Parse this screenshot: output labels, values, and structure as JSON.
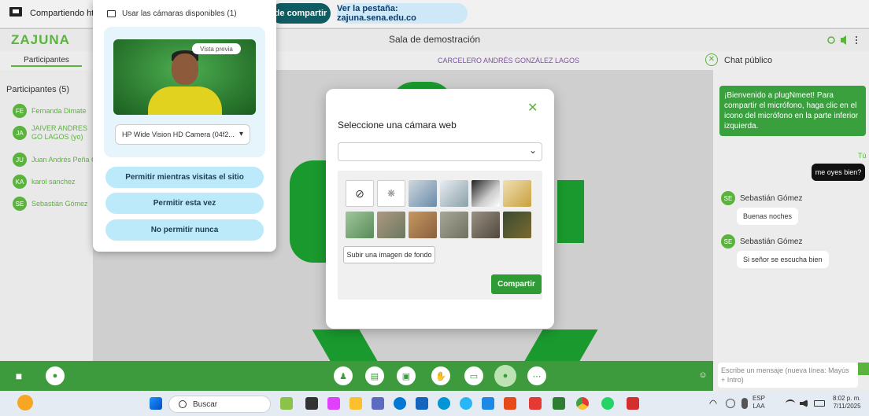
{
  "sharebar": {
    "text": "Compartiendo htt",
    "stop_label": "de compartir",
    "tab_label": "Ver la pestaña: zajuna.sena.edu.co"
  },
  "header": {
    "logo": "ZAJUNA",
    "room": "Sala de demostración"
  },
  "subheader": {
    "tab": "Participantes",
    "speaker": "CARCELERO ANDRÉS GONZÁLEZ LAGOS",
    "chat_title": "Chat público"
  },
  "participants": {
    "title": "Participantes (5)",
    "items": [
      {
        "initials": "FE",
        "name": "Fernanda Dimate"
      },
      {
        "initials": "JA",
        "name": "JAIVER ANDRES GO LAGOS (yo)"
      },
      {
        "initials": "JU",
        "name": "Juan Andrés Peña C"
      },
      {
        "initials": "KA",
        "name": "karol sanchez"
      },
      {
        "initials": "SE",
        "name": "Sebastián Gómez"
      }
    ]
  },
  "camera_popup": {
    "header": "Usar las cámaras disponibles (1)",
    "preview": "Vista previa",
    "device": "HP Wide Vision HD Camera (04f2...",
    "allow_visit": "Permitir mientras visitas el sitio",
    "allow_once": "Permitir esta vez",
    "never": "No permitir nunca"
  },
  "modal": {
    "title": "Seleccione una cámara web",
    "upload": "Subir una imagen de fondo",
    "share": "Compartir",
    "close": "✕"
  },
  "chat": {
    "welcome": "¡Bienvenido a plugNmeet! Para compartir el micrófono, haga clic en el icono del micrófono en la parte inferior izquierda.",
    "me_label": "Tú",
    "my_message": "me oyes bien?",
    "messages": [
      {
        "initials": "SE",
        "sender": "Sebastián Gómez",
        "text": "Buenas noches"
      },
      {
        "initials": "SE",
        "sender": "Sebastián Gómez",
        "text": "Si señor se escucha bien"
      }
    ],
    "input_placeholder": "Escribe un mensaje (nueva línea: Mayús + Intro)"
  },
  "taskbar": {
    "search": "Buscar",
    "lang": "ESP",
    "lang2": "LAA",
    "time": "8:02 p. m.",
    "date": "7/11/2025"
  },
  "colors": {
    "accent": "#5ab33d",
    "toolbar": "#3d9a3d",
    "stop": "#0f5c63"
  }
}
